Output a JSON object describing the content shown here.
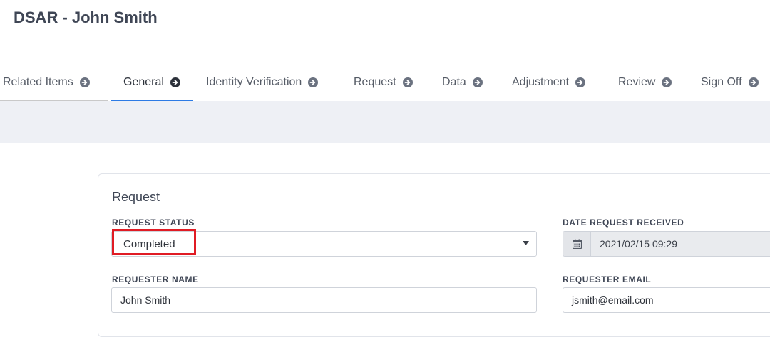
{
  "page": {
    "title": "DSAR - John Smith"
  },
  "tabs": [
    {
      "label": "Related Items",
      "icon": "arrow-circle-right-icon"
    },
    {
      "label": "General",
      "icon": "arrow-circle-right-icon",
      "active": true
    },
    {
      "label": "Identity Verification",
      "icon": "arrow-circle-right-icon"
    },
    {
      "label": "Request",
      "icon": "arrow-circle-right-icon"
    },
    {
      "label": "Data",
      "icon": "arrow-circle-right-icon"
    },
    {
      "label": "Adjustment",
      "icon": "arrow-circle-right-icon"
    },
    {
      "label": "Review",
      "icon": "arrow-circle-right-icon"
    },
    {
      "label": "Sign Off",
      "icon": "arrow-circle-right-icon"
    }
  ],
  "colors": {
    "active_tab_underline": "#2d7be5",
    "visited_tab_underline": "#c9c9c9",
    "highlight_border": "#e01b24"
  },
  "card": {
    "title": "Request",
    "request_status": {
      "label": "REQUEST STATUS",
      "value": "Completed"
    },
    "date_received": {
      "label": "DATE REQUEST RECEIVED",
      "value": "2021/02/15 09:29",
      "icon": "calendar-icon"
    },
    "requester_name": {
      "label": "REQUESTER NAME",
      "value": "John Smith"
    },
    "requester_email": {
      "label": "REQUESTER EMAIL",
      "value": "jsmith@email.com"
    }
  }
}
